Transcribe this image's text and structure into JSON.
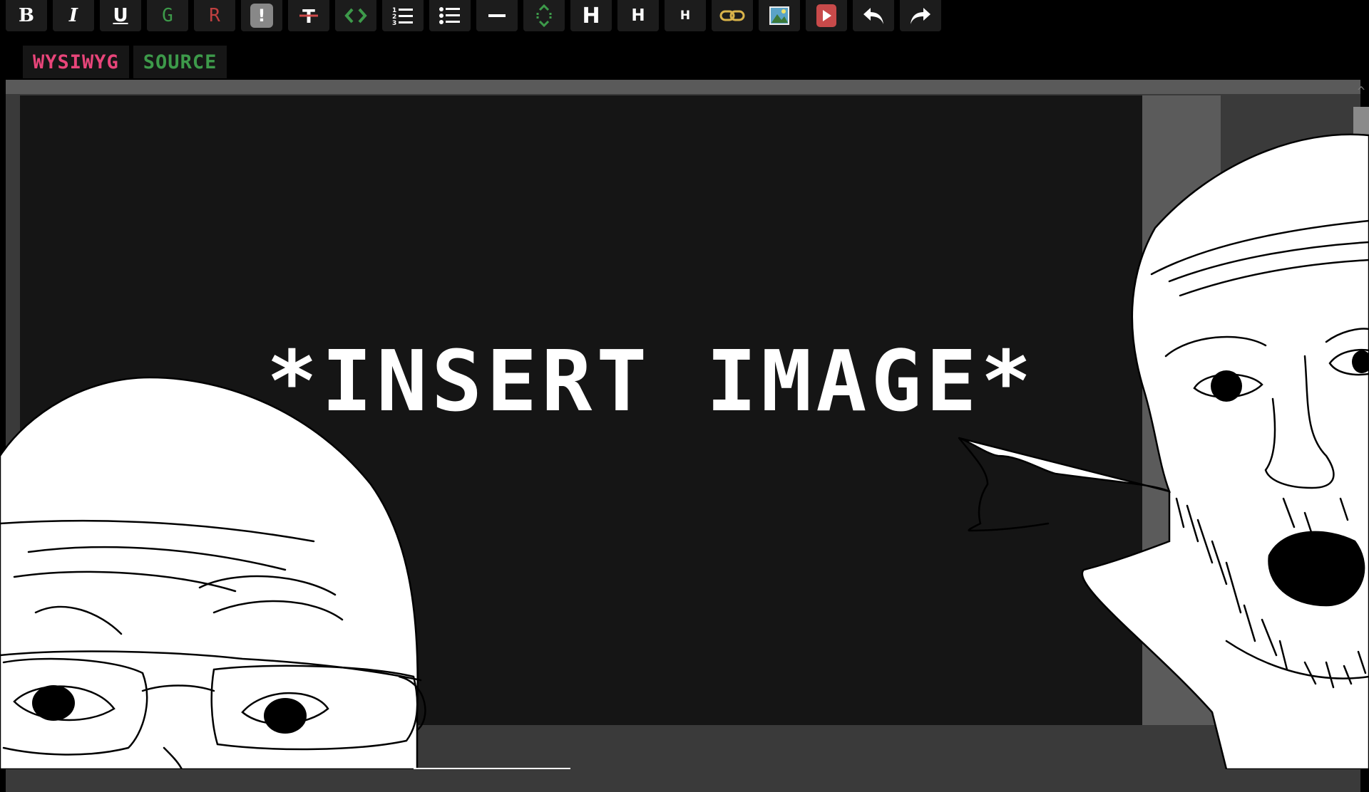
{
  "toolbar": {
    "buttons": [
      {
        "name": "bold-button",
        "label": "B",
        "icon": "bold-icon"
      },
      {
        "name": "italic-button",
        "label": "I",
        "icon": "italic-icon"
      },
      {
        "name": "underline-button",
        "label": "U",
        "icon": "underline-icon"
      },
      {
        "name": "green-text-button",
        "label": "G",
        "icon": "green-text-icon",
        "color": "#3d9a4a"
      },
      {
        "name": "red-text-button",
        "label": "R",
        "icon": "red-text-icon",
        "color": "#c04040"
      },
      {
        "name": "spoiler-button",
        "label": "!",
        "icon": "spoiler-icon"
      },
      {
        "name": "strikethrough-button",
        "label": "",
        "icon": "strikethrough-icon"
      },
      {
        "name": "code-button",
        "label": "",
        "icon": "code-icon",
        "color": "#3d9a4a"
      },
      {
        "name": "ordered-list-button",
        "label": "",
        "icon": "ordered-list-icon"
      },
      {
        "name": "unordered-list-button",
        "label": "",
        "icon": "unordered-list-icon"
      },
      {
        "name": "horizontal-rule-button",
        "label": "",
        "icon": "horizontal-rule-icon"
      },
      {
        "name": "expand-button",
        "label": "",
        "icon": "expand-icon",
        "color": "#3d9a4a"
      },
      {
        "name": "heading-1-button",
        "label": "H",
        "icon": "heading-1-icon"
      },
      {
        "name": "heading-2-button",
        "label": "H",
        "icon": "heading-2-icon"
      },
      {
        "name": "heading-3-button",
        "label": "H",
        "icon": "heading-3-icon"
      },
      {
        "name": "link-button",
        "label": "",
        "icon": "link-icon",
        "color": "#d9b34a"
      },
      {
        "name": "image-button",
        "label": "",
        "icon": "image-icon"
      },
      {
        "name": "video-button",
        "label": "",
        "icon": "video-play-icon",
        "color": "#c84a4a"
      },
      {
        "name": "undo-button",
        "label": "",
        "icon": "undo-icon"
      },
      {
        "name": "redo-button",
        "label": "",
        "icon": "redo-icon"
      }
    ]
  },
  "tabs": {
    "wysiwyg": "WYSIWYG",
    "source": "SOURCE"
  },
  "editor": {
    "content": "*INSERT IMAGE*"
  },
  "colors": {
    "accent_pink": "#e8457a",
    "accent_green": "#3d9a4a",
    "editor_bg": "#151515"
  }
}
